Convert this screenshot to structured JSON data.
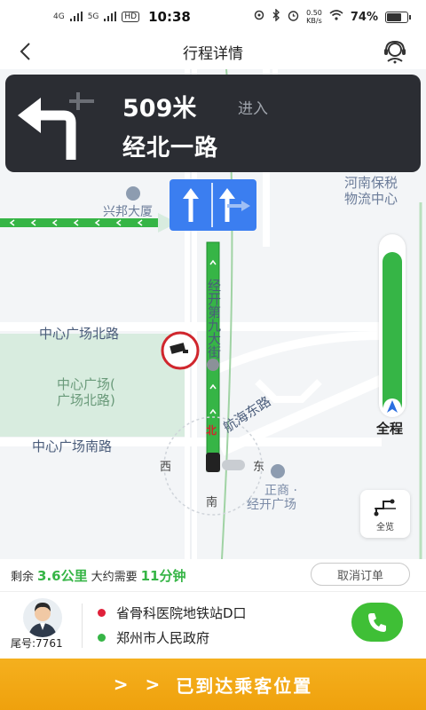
{
  "status_bar": {
    "net1": "4G",
    "net2": "5G",
    "hd": "HD",
    "time": "10:38",
    "speed_value": "0.50",
    "speed_unit": "KB/s",
    "battery": "74%",
    "battery_level": 0.74
  },
  "header": {
    "title": "行程详情",
    "back_icon": "chevron-left-icon",
    "support_icon": "customer-service-icon"
  },
  "navigation": {
    "distance": "509米",
    "action": "进入",
    "road": "经北一路",
    "turn_icon": "turn-left-icon"
  },
  "map": {
    "labels": {
      "building_xingbang": "兴邦大厦",
      "henan_bonded_1": "河南保税",
      "henan_bonded_2": "物流中心",
      "road_jingkai_9": "经开第九大街",
      "central_plaza_north_road": "中心广场北路",
      "central_plaza_1": "中心广场(",
      "central_plaza_2": "广场北路)",
      "central_plaza_south_road": "中心广场南路",
      "hanghai_east_road": "航海东路",
      "zhengshang_1": "正商 ·",
      "zhengshang_2": "经开广场",
      "compass_west": "西",
      "compass_east": "东",
      "compass_south": "南",
      "compass_north": "北"
    },
    "route_progress": 0.92,
    "overview_label": "全程",
    "fullview_label": "全览",
    "colors": {
      "route": "#36b546",
      "lane_panel": "#3b7ef0",
      "camera": "#d0262d"
    }
  },
  "trip": {
    "remaining_label": "剩余",
    "remaining_distance": "3.6公里",
    "eta_label": "大约需要",
    "eta": "11分钟",
    "cancel_label": "取消订单",
    "plate": "尾号:7761",
    "from": "省骨科医院地铁站D口",
    "to": "郑州市人民政府",
    "from_color": "#e0213a",
    "to_color": "#36b546"
  },
  "action": {
    "chevrons": "> >",
    "label": "已到达乘客位置"
  }
}
